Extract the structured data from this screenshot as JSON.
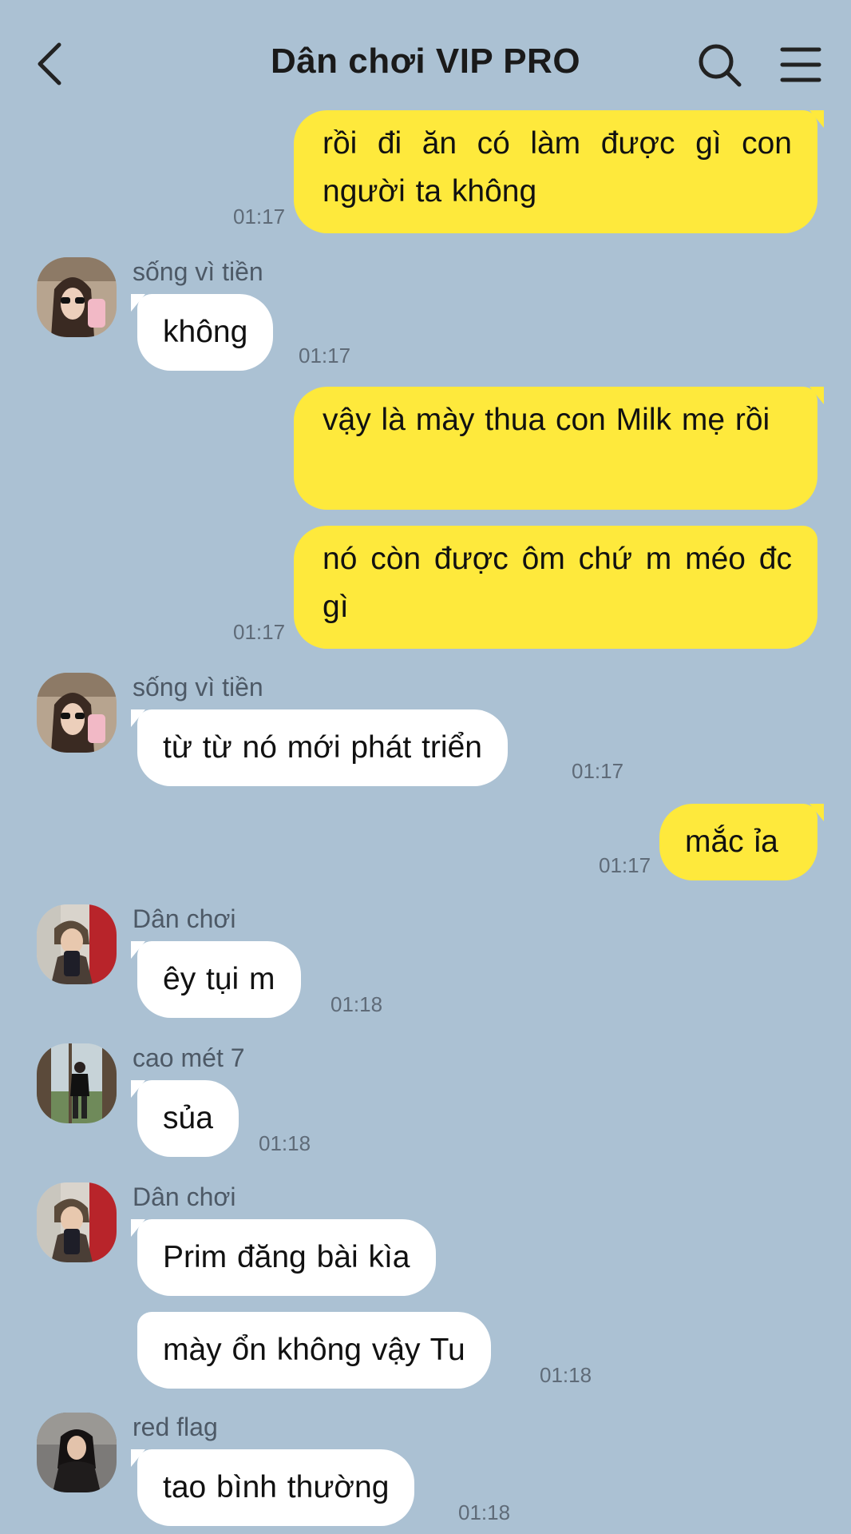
{
  "header": {
    "title": "Dân chơi VIP PRO",
    "back_icon": "chevron-left-icon",
    "search_icon": "search-icon",
    "menu_icon": "hamburger-menu-icon"
  },
  "colors": {
    "background": "#abc1d3",
    "my_bubble": "#fee93c",
    "their_bubble": "#ffffff"
  },
  "messages": [
    {
      "from": "me",
      "text": "rồi đi ăn có làm được gì con người ta không",
      "time": "01:17"
    },
    {
      "from": "sống vì tiền",
      "text": "không",
      "time": "01:17"
    },
    {
      "from": "me",
      "text": "vậy là mày thua con Milk mẹ rồi",
      "time": ""
    },
    {
      "from": "me",
      "text": "nó còn được ôm chứ m méo đc gì",
      "time": "01:17"
    },
    {
      "from": "sống vì tiền",
      "text": "từ từ nó mới phát triển",
      "time": "01:17"
    },
    {
      "from": "me",
      "text": "mắc ỉa",
      "time": "01:17"
    },
    {
      "from": "Dân chơi",
      "text": "êy tụi m",
      "time": "01:18"
    },
    {
      "from": "cao mét 7",
      "text": "sủa",
      "time": "01:18"
    },
    {
      "from": "Dân chơi",
      "text": "Prim đăng bài kìa",
      "time": ""
    },
    {
      "from": "Dân chơi",
      "text": "mày ổn không vậy Tu",
      "time": "01:18"
    },
    {
      "from": "red flag",
      "text": "tao bình thường",
      "time": "01:18"
    }
  ]
}
